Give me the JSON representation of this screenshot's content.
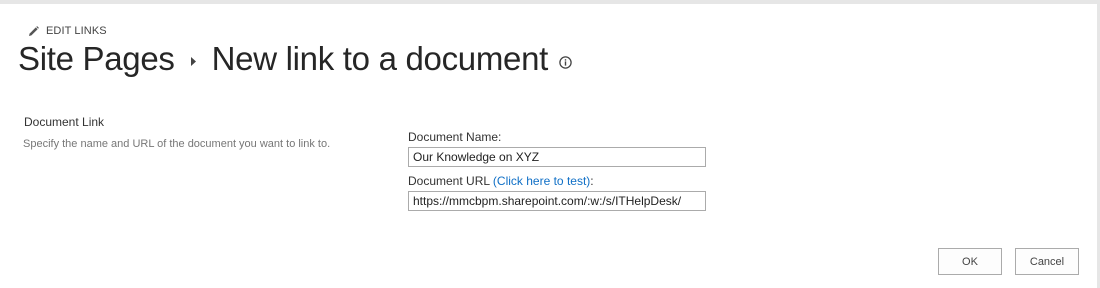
{
  "edit_links": {
    "label": "EDIT LINKS",
    "icon": "pencil-icon"
  },
  "title": {
    "parent": "Site Pages",
    "current": "New link to a document",
    "separator_icon": "breadcrumb-arrow-icon",
    "info_icon": "info-icon"
  },
  "section": {
    "title": "Document Link",
    "description": "Specify the name and URL of the document you want to link to."
  },
  "fields": {
    "name": {
      "label": "Document Name:",
      "value": "Our Knowledge on XYZ"
    },
    "url": {
      "label_prefix": "Document URL ",
      "test_link": "(Click here to test)",
      "label_suffix": ":",
      "value": "https://mmcbpm.sharepoint.com/:w:/s/ITHelpDesk/"
    }
  },
  "buttons": {
    "ok": "OK",
    "cancel": "Cancel"
  },
  "colors": {
    "link": "#0f6fc6",
    "title_text": "#262626",
    "muted_text": "#777777",
    "input_border": "#ababab"
  }
}
